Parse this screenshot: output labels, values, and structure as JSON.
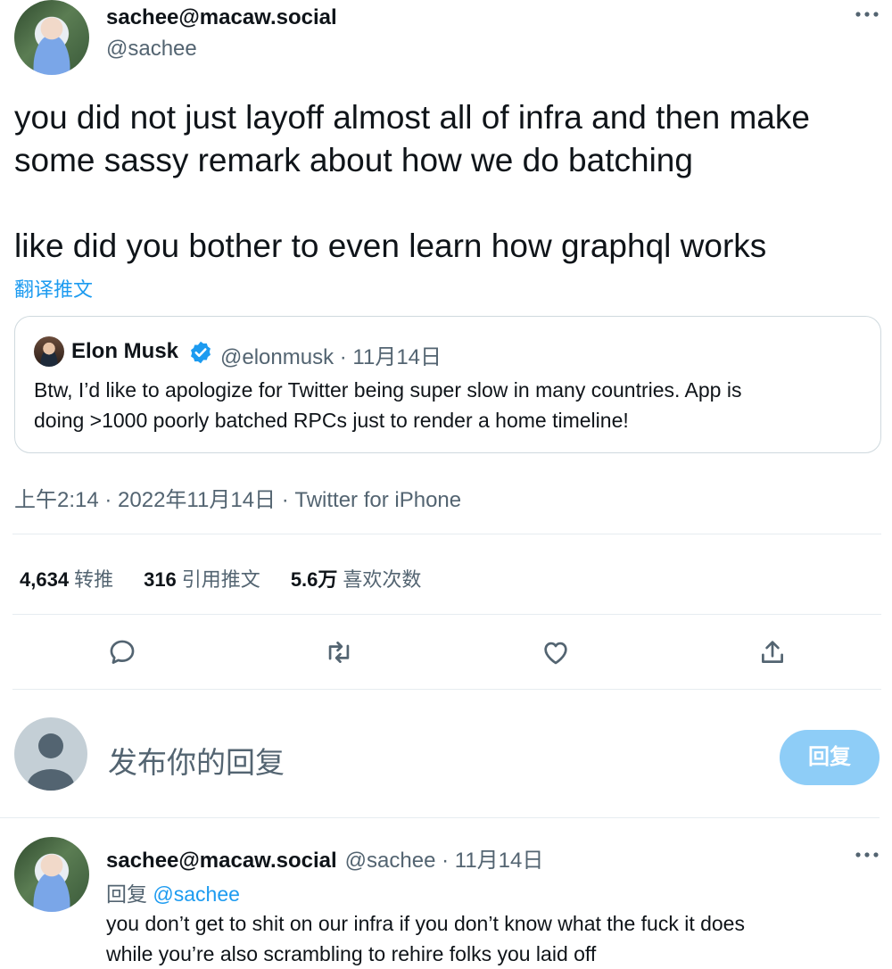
{
  "tweet": {
    "author_name": "sachee@macaw.social",
    "author_handle": "@sachee",
    "more_icon": "ellipsis-icon",
    "text_line1": "you did not just layoff almost all of infra and then make",
    "text_line2": "some sassy remark about how we do batching",
    "text_line3": "like did you bother to even learn how graphql works",
    "translate": "翻译推文",
    "quote": {
      "name": "Elon Musk",
      "handle_date": "@elonmusk · 11月14日",
      "verified_icon": "verified-badge-icon",
      "text_line1": "Btw, I’d like to apologize for Twitter being super slow in many countries. App is",
      "text_line2": "doing >1000 poorly batched RPCs just to render a home timeline!"
    },
    "meta": "上午2:14 · 2022年11月14日 · Twitter for iPhone",
    "stats": {
      "retweets_num": "4,634",
      "retweets_label": "转推",
      "quotes_num": "316",
      "quotes_label": "引用推文",
      "likes_num": "5.6万",
      "likes_label": "喜欢次数"
    },
    "actions": [
      "reply-icon",
      "retweet-icon",
      "like-icon",
      "share-icon"
    ]
  },
  "compose": {
    "placeholder": "发布你的回复",
    "button": "回复"
  },
  "reply": {
    "author_name": "sachee@macaw.social",
    "handle_date": "@sachee · 11月14日",
    "replying_prefix": "回复",
    "replying_to": "@sachee",
    "text_line1": "you don’t get to shit on our infra if you don’t know what the fuck it does",
    "text_line2": "while you’re also scrambling to rehire folks you laid off"
  },
  "colors": {
    "accent": "#1d9bf0",
    "secondary_text": "#536471",
    "reply_button": "#8ecdf7"
  }
}
